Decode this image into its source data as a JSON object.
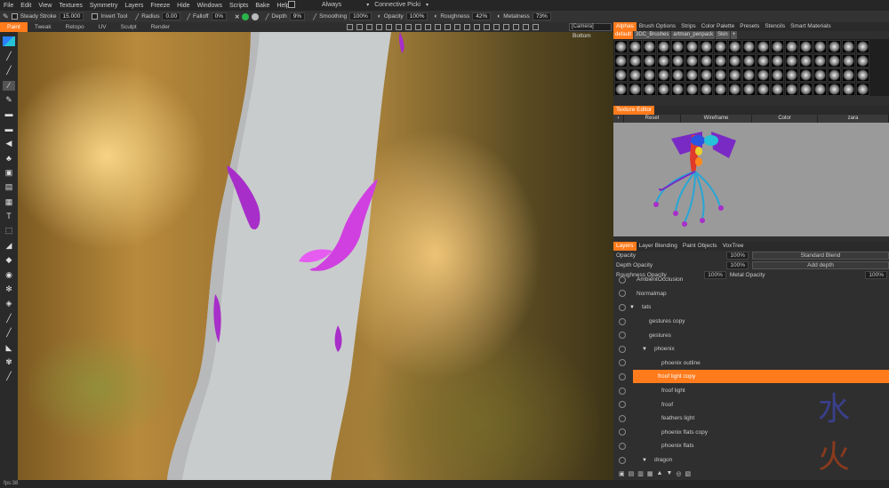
{
  "menu": {
    "items": [
      "File",
      "Edit",
      "View",
      "Textures",
      "Symmetry",
      "Layers",
      "Freeze",
      "Hide",
      "Windows",
      "Scripts",
      "Bake",
      "Help"
    ],
    "always_label": "Always",
    "connective_label": "Connective Picki"
  },
  "toolbar": {
    "steady_stroke_label": "Steady Stroke",
    "steady_stroke_value": "15.000",
    "invert_tool_label": "Invert Tool",
    "radius_label": "Radius",
    "radius_value": "0.00",
    "falloff_label": "Falloff",
    "falloff_value": "0%",
    "depth_label": "Depth",
    "depth_value": "9%",
    "smoothing_label": "Smoothing",
    "smoothing_value": "100%",
    "opacity_label": "Opacity",
    "opacity_value": "100%",
    "roughness_label": "Roughness",
    "roughness_value": "42%",
    "metalness_label": "Metalness",
    "metalness_value": "73%",
    "green_dot": "#29b34a",
    "gray_dot": "#bbbbbb"
  },
  "mode_tabs": [
    {
      "label": "Paint",
      "active": true
    },
    {
      "label": "Tweak",
      "active": false
    },
    {
      "label": "Retopo",
      "active": false
    },
    {
      "label": "UV",
      "active": false
    },
    {
      "label": "Sculpt",
      "active": false
    },
    {
      "label": "Render",
      "active": false
    }
  ],
  "camera_select": "[Camera]",
  "viewport": {
    "bottom_label": "Bottom"
  },
  "right_panel": {
    "top_tabs": [
      {
        "label": "Alphas",
        "active": true
      },
      {
        "label": "Brush Options",
        "active": false
      },
      {
        "label": "Strips",
        "active": false
      },
      {
        "label": "Color Palette",
        "active": false
      },
      {
        "label": "Presets",
        "active": false
      },
      {
        "label": "Stencils",
        "active": false
      },
      {
        "label": "Smart Materials",
        "active": false
      }
    ],
    "alpha_subtabs": [
      {
        "label": "default",
        "active": true
      },
      {
        "label": "3DC_Brushes",
        "active": false
      },
      {
        "label": "artman_penpack",
        "active": false
      },
      {
        "label": "Skin",
        "active": false
      }
    ],
    "texture_editor_tab": "Texture Editor",
    "te_header": [
      "Reset",
      "Wireframe",
      "Color",
      "zara"
    ],
    "layer_tabs": [
      {
        "label": "Layers",
        "active": true
      },
      {
        "label": "Layer Blending",
        "active": false
      },
      {
        "label": "Paint Objects",
        "active": false
      },
      {
        "label": "VoxTree",
        "active": false
      }
    ],
    "props": {
      "opacity_label": "Opacity",
      "opacity_value": "100%",
      "blend_mode": "Standard Blend",
      "depth_opacity_label": "Depth Opacity",
      "depth_opacity_value": "100%",
      "depth_mode": "Add depth",
      "roughness_opacity_label": "Roughness Opacity",
      "roughness_opacity_value": "100%",
      "metal_opacity_label": "Metal Opacity",
      "metal_opacity_value": "100%"
    },
    "layers": [
      {
        "name": "AmbientOcclusion",
        "indent": 0,
        "expand": "",
        "selected": false
      },
      {
        "name": "Normalmap",
        "indent": 0,
        "expand": "",
        "selected": false
      },
      {
        "name": "tats",
        "indent": 0,
        "expand": "▼",
        "selected": false
      },
      {
        "name": "gestures  copy",
        "indent": 1,
        "expand": "",
        "selected": false
      },
      {
        "name": "gestures",
        "indent": 1,
        "expand": "",
        "selected": false
      },
      {
        "name": "phoenix",
        "indent": 1,
        "expand": "▼",
        "selected": false
      },
      {
        "name": "phoenix  outline",
        "indent": 2,
        "expand": "",
        "selected": false
      },
      {
        "name": "froof  light  copy",
        "indent": 2,
        "expand": "",
        "selected": true
      },
      {
        "name": "froof  light",
        "indent": 2,
        "expand": "",
        "selected": false
      },
      {
        "name": "froof",
        "indent": 2,
        "expand": "",
        "selected": false
      },
      {
        "name": "feathers  light",
        "indent": 2,
        "expand": "",
        "selected": false
      },
      {
        "name": "phoenix  flats  copy",
        "indent": 2,
        "expand": "",
        "selected": false
      },
      {
        "name": "phoenix  flats",
        "indent": 2,
        "expand": "",
        "selected": false
      },
      {
        "name": "dragon",
        "indent": 1,
        "expand": "▼",
        "selected": false
      }
    ]
  },
  "status": {
    "fps": "fps:38"
  }
}
